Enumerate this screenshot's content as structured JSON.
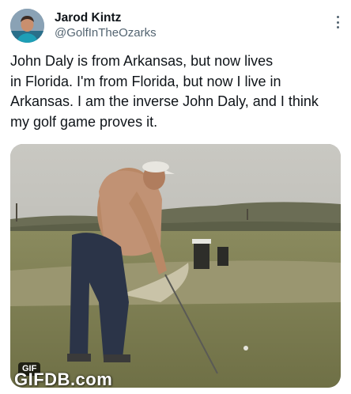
{
  "tweet": {
    "author": {
      "name": "Jarod Kintz",
      "handle": "@GolfInTheOzarks"
    },
    "text_lines": [
      "John Daly is from Arkansas, but now lives",
      "in Florida. I'm from Florida, but now I live in",
      "Arkansas. I am the inverse John Daly, and I think",
      "my golf game proves it."
    ],
    "media": {
      "badge": "GIF",
      "watermark": "GIFDB.com"
    }
  },
  "icons": {
    "more": "more-options-icon"
  }
}
